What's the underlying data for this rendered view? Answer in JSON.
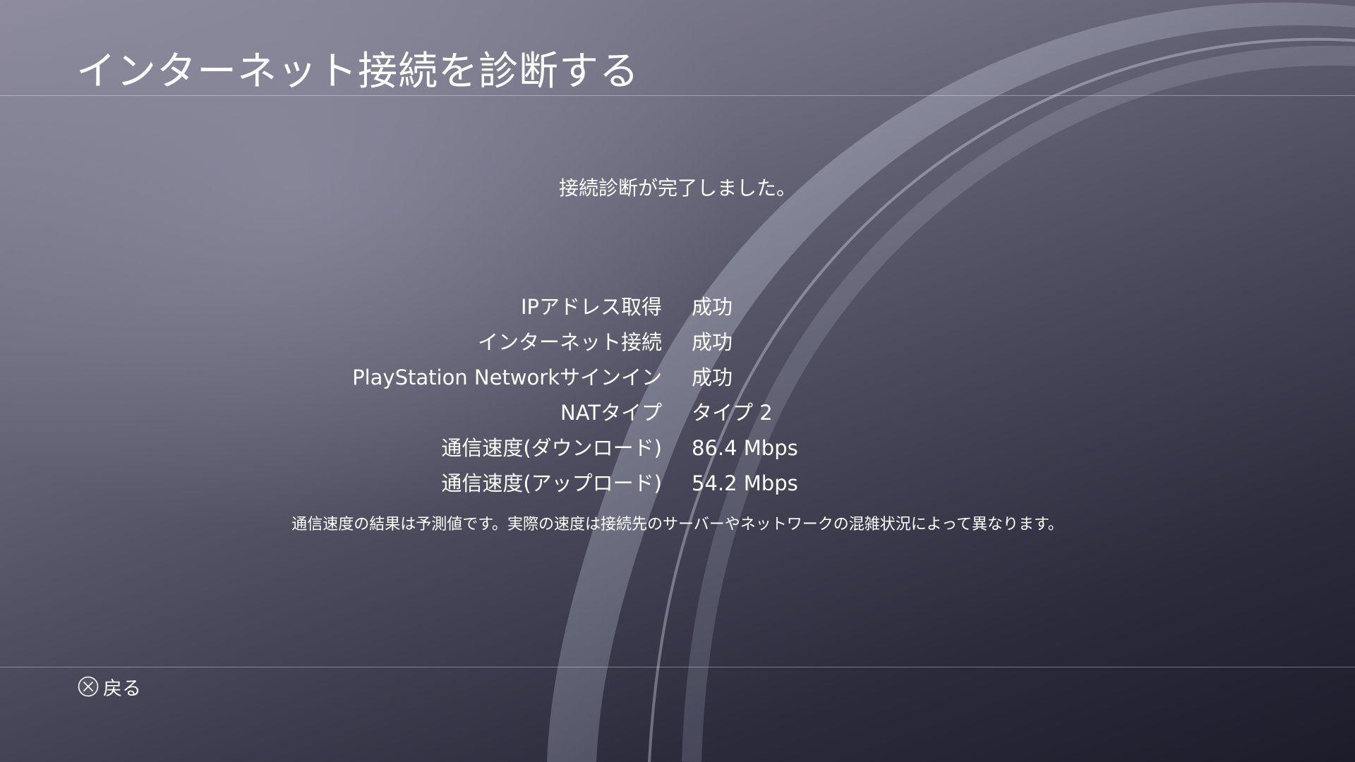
{
  "header": {
    "title": "インターネット接続を診断する"
  },
  "status_message": "接続診断が完了しました。",
  "results": [
    {
      "label": "IPアドレス取得",
      "value": "成功"
    },
    {
      "label": "インターネット接続",
      "value": "成功"
    },
    {
      "label": "PlayStation Networkサインイン",
      "value": "成功"
    },
    {
      "label": "NATタイプ",
      "value": "タイプ 2"
    },
    {
      "label": "通信速度(ダウンロード)",
      "value": "86.4 Mbps"
    },
    {
      "label": "通信速度(アップロード)",
      "value": "54.2 Mbps"
    }
  ],
  "note": "通信速度の結果は予測値です。実際の速度は接続先のサーバーやネットワークの混雑状況によって異なります。",
  "footer": {
    "back_icon": "cross-button-icon",
    "back_label": "戻る"
  },
  "colors": {
    "text": "#ffffff",
    "background_top": "#8c8a9c",
    "background_bottom": "#1c1c2a"
  }
}
